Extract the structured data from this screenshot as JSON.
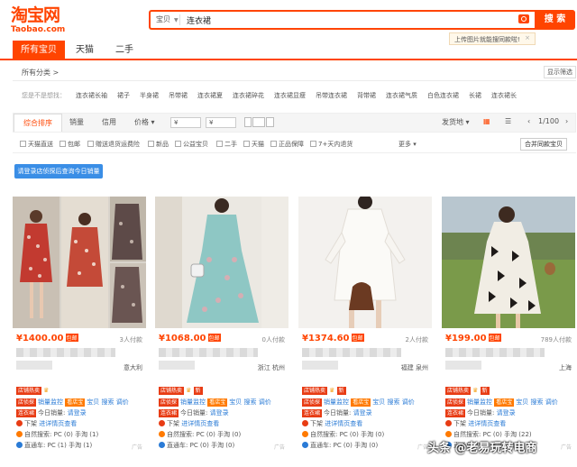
{
  "header": {
    "logo_cn": "淘宝网",
    "logo_en": "Taobao.com",
    "search_category": "宝贝",
    "search_value": "连衣裙",
    "search_button": "搜 索",
    "tip": "上传图片就能搜同款啦!",
    "tabs": [
      "所有宝贝",
      "天猫",
      "二手"
    ]
  },
  "crumb": {
    "left": "所有分类 >",
    "right": "显示筛选"
  },
  "related": {
    "label": "您是不是想找：",
    "items": [
      "连衣裙长袖",
      "裙子",
      "半身裙",
      "吊带裙",
      "连衣裙夏",
      "连衣裙碎花",
      "连衣裙显瘦",
      "吊带连衣裙",
      "背带裙",
      "连衣裙气质",
      "白色连衣裙",
      "长裙",
      "连衣裙长"
    ]
  },
  "sort": {
    "items": [
      "综合排序",
      "销量",
      "信用",
      "价格"
    ],
    "price_from": "¥",
    "price_to": "¥",
    "ship_from": "发货地",
    "page": "1/100"
  },
  "filters": [
    "天猫直送",
    "包邮",
    "赠送退货运费险",
    "新品",
    "公益宝贝",
    "二手",
    "天猫",
    "正品保障",
    "7+天内退货"
  ],
  "more": "更多",
  "merge": "合并同款宝贝",
  "login_button": "请登录店侦探后查询今日销量",
  "products": [
    {
      "price": "¥1400.00",
      "bao": "包邮",
      "buyers": "3人付款",
      "loc": "意大利",
      "sales_row": "请登录",
      "promo": "进详情页查看",
      "search_row": "PC (0) 手淘 (1)",
      "direct_row": "PC (1) 手淘 (1)"
    },
    {
      "price": "¥1068.00",
      "bao": "包邮",
      "buyers": "0人付款",
      "loc": "浙江 杭州",
      "sales_row": "请登录",
      "promo": "进详情页查看",
      "search_row": "PC (0) 手淘 (0)",
      "direct_row": "PC (0) 手淘 (0)"
    },
    {
      "price": "¥1374.60",
      "bao": "包邮",
      "buyers": "2人付款",
      "loc": "福建 泉州",
      "sales_row": "请登录",
      "promo": "进详情页查看",
      "search_row": "PC (0) 手淘 (0)",
      "direct_row": "PC (0) 手淘 (0)"
    },
    {
      "price": "¥199.00",
      "bao": "包邮",
      "buyers": "789人付款",
      "loc": "上海",
      "sales_row": "请登录",
      "promo": "进详情页查看",
      "search_row": "PC (0) 手淘 (22)",
      "direct_row": "PC (0) 手淘 (0)"
    }
  ],
  "labels": {
    "shop_hot": "店铺热卖",
    "new": "新",
    "store_rec": "店侦探",
    "sales_monitor": "销量监控",
    "look_store": "看店宝",
    "baby": "宝贝",
    "search": "搜索",
    "adjust": "调价",
    "lian": "连衣裙",
    "today_sales": "今日销量:",
    "down": "下架",
    "natural": "自然搜索:",
    "direct": "直通车:",
    "ad": "广告"
  },
  "watermark": "头条 @老易玩转电商"
}
